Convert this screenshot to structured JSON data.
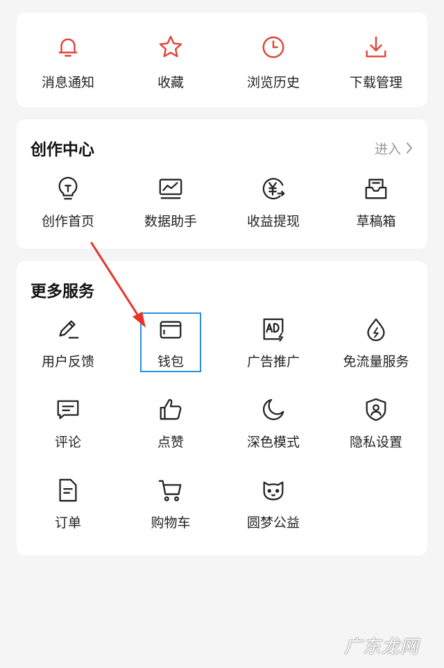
{
  "top_shortcuts": [
    {
      "label": "消息通知",
      "icon": "bell-icon"
    },
    {
      "label": "收藏",
      "icon": "star-icon"
    },
    {
      "label": "浏览历史",
      "icon": "clock-icon"
    },
    {
      "label": "下载管理",
      "icon": "download-icon"
    }
  ],
  "creation": {
    "title": "创作中心",
    "enter_label": "进入",
    "items": [
      {
        "label": "创作首页",
        "icon": "lightbulb-icon"
      },
      {
        "label": "数据助手",
        "icon": "chart-monitor-icon"
      },
      {
        "label": "收益提现",
        "icon": "yen-withdraw-icon"
      },
      {
        "label": "草稿箱",
        "icon": "draft-box-icon"
      }
    ]
  },
  "more_services": {
    "title": "更多服务",
    "items": [
      {
        "label": "用户反馈",
        "icon": "pencil-feedback-icon"
      },
      {
        "label": "钱包",
        "icon": "wallet-icon",
        "highlighted": true
      },
      {
        "label": "广告推广",
        "icon": "ad-icon"
      },
      {
        "label": "免流量服务",
        "icon": "flow-drop-icon"
      },
      {
        "label": "评论",
        "icon": "comment-icon"
      },
      {
        "label": "点赞",
        "icon": "thumbs-up-icon"
      },
      {
        "label": "深色模式",
        "icon": "moon-icon"
      },
      {
        "label": "隐私设置",
        "icon": "shield-user-icon"
      },
      {
        "label": "订单",
        "icon": "order-doc-icon"
      },
      {
        "label": "购物车",
        "icon": "cart-icon"
      },
      {
        "label": "圆梦公益",
        "icon": "cat-face-icon"
      }
    ]
  },
  "colors": {
    "accent_red": "#e0453a",
    "highlight_blue": "#2a8de2",
    "arrow_red": "#e8322a"
  },
  "watermark": "广东龙网"
}
